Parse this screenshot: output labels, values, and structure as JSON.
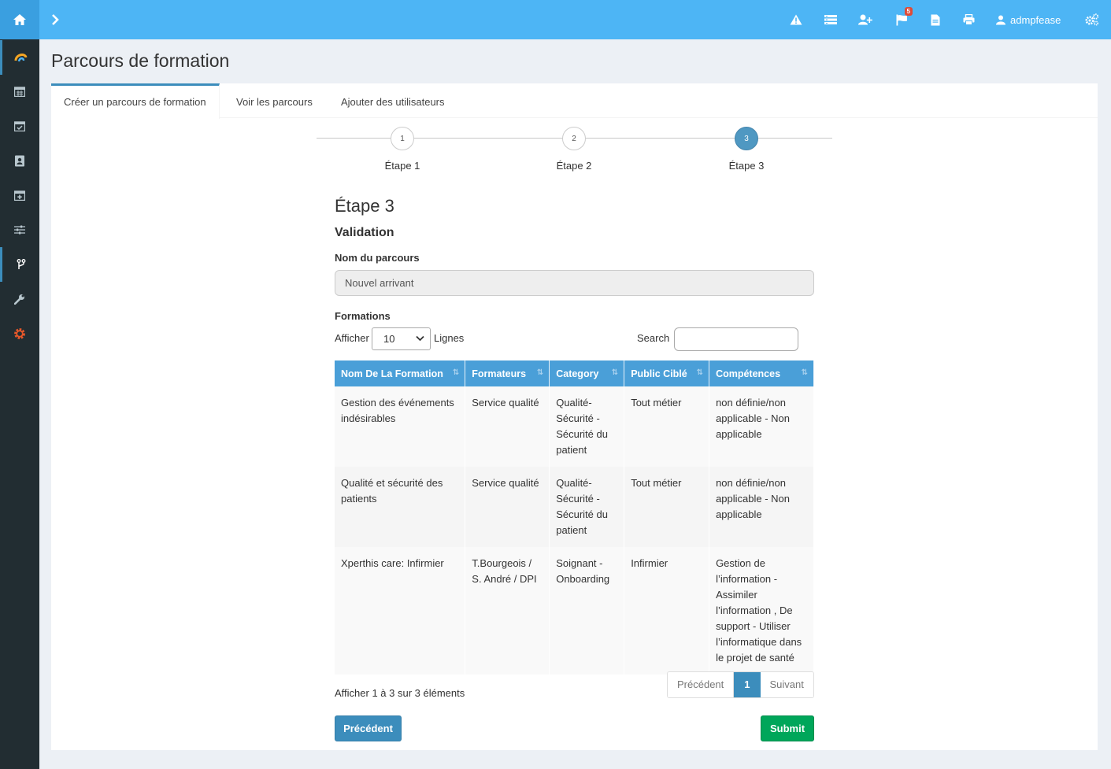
{
  "topbar": {
    "user_name": "admpfease",
    "flag_badge": "5",
    "icons": [
      "home-icon",
      "chevron-right-icon",
      "warning-icon",
      "list-icon",
      "user-plus-icon",
      "flag-icon",
      "file-icon",
      "print-icon",
      "user-icon",
      "cogs-icon"
    ]
  },
  "sidebar": {
    "icons": [
      "logo-icon",
      "calendar-icon",
      "calendar-check-icon",
      "address-book-icon",
      "calendar-plus-icon",
      "sliders-icon",
      "code-fork-icon",
      "wrench-icon",
      "gear-icon"
    ]
  },
  "page": {
    "title": "Parcours de formation"
  },
  "tabs": [
    {
      "label": "Créer un parcours de formation"
    },
    {
      "label": "Voir les parcours"
    },
    {
      "label": "Ajouter des utilisateurs"
    }
  ],
  "stepper": [
    {
      "number": "1",
      "label": "Étape 1"
    },
    {
      "number": "2",
      "label": "Étape 2"
    },
    {
      "number": "3",
      "label": "Étape 3"
    }
  ],
  "form": {
    "step_title": "Étape 3",
    "section_title": "Validation",
    "name_label": "Nom du parcours",
    "name_value": "Nouvel arrivant",
    "formations_label": "Formations",
    "show_label": "Afficher",
    "show_value": "10",
    "rows_label": "Lignes",
    "search_label": "Search",
    "search_value": ""
  },
  "table": {
    "headers": [
      "Nom De La Formation",
      "Formateurs",
      "Category",
      "Public Ciblé",
      "Compétences"
    ],
    "rows": [
      [
        "Gestion des événements indésirables",
        "Service qualité",
        "Qualité-Sécurité - Sécurité du patient",
        "Tout métier",
        "non définie/non applicable - Non applicable"
      ],
      [
        "Qualité et sécurité des patients",
        "Service qualité",
        "Qualité-Sécurité - Sécurité du patient",
        "Tout métier",
        "non définie/non applicable - Non applicable"
      ],
      [
        "Xperthis care: Infirmier",
        "T.Bourgeois / S. André / DPI",
        "Soignant - Onboarding",
        "Infirmier",
        "Gestion de l’information - Assimiler l’information , De support - Utiliser l’informatique dans le projet de santé"
      ]
    ]
  },
  "pagination": {
    "info": "Afficher 1 à 3 sur 3 éléments",
    "prev": "Précédent",
    "current": "1",
    "next": "Suivant"
  },
  "buttons": {
    "previous": "Précédent",
    "submit": "Submit"
  },
  "colors": {
    "topbar": "#4db5f5",
    "sidebar": "#222d32",
    "primary": "#3c8dbc",
    "success": "#00a65a",
    "table_header": "#4a9fd8"
  }
}
